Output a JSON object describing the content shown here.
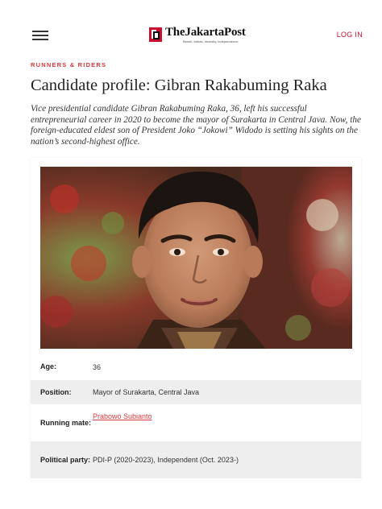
{
  "header": {
    "menu_icon": "hamburger-menu-icon",
    "logo_text": "TheJakartaPost",
    "logo_tagline": "Bersih, bebas, diversity, independence",
    "login_label": "LOG IN",
    "brand_color": "#c8102e"
  },
  "article": {
    "category": "RUNNERS & RIDERS",
    "title": "Candidate profile: Gibran Rakabuming Raka",
    "lede": "Vice presidential candidate Gibran Rakabuming Raka, 36, left his successful entrepreneurial career in 2020 to become the mayor of Surakarta in Central Java. Now, the foreign-educated eldest son of President Joko “Jokowi” Widodo is setting his sights on the nation’s second-highest office."
  },
  "profile": {
    "photo_alt": "Gibran Rakabuming Raka",
    "rows": [
      {
        "label": "Age:",
        "value": "36"
      },
      {
        "label": "Position:",
        "value": "Mayor of Surakarta, Central Java"
      },
      {
        "label": "Running mate:",
        "value": "Prabowo Subianto",
        "link": true
      },
      {
        "label": "Political party:",
        "value": "PDI-P (2020-2023), Independent (Oct. 2023-)"
      }
    ]
  },
  "colors": {
    "accent": "#d6393d",
    "row_shade": "#eeeeee"
  }
}
